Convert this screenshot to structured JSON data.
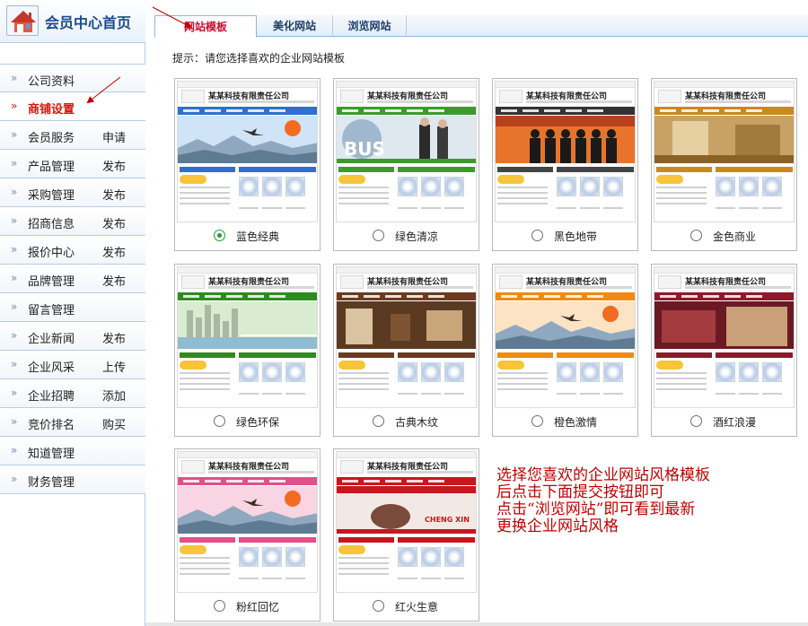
{
  "sidebar": {
    "title": "会员中心首页",
    "items": [
      {
        "label": "公司资料",
        "action": ""
      },
      {
        "label": "商铺设置",
        "action": "",
        "active": true
      },
      {
        "label": "会员服务",
        "action": "申请"
      },
      {
        "label": "产品管理",
        "action": "发布"
      },
      {
        "label": "采购管理",
        "action": "发布"
      },
      {
        "label": "招商信息",
        "action": "发布"
      },
      {
        "label": "报价中心",
        "action": "发布"
      },
      {
        "label": "品牌管理",
        "action": "发布"
      },
      {
        "label": "留言管理",
        "action": ""
      },
      {
        "label": "企业新闻",
        "action": "发布"
      },
      {
        "label": "企业风采",
        "action": "上传"
      },
      {
        "label": "企业招聘",
        "action": "添加"
      },
      {
        "label": "竞价排名",
        "action": "购买"
      },
      {
        "label": "知道管理",
        "action": ""
      },
      {
        "label": "财务管理",
        "action": ""
      }
    ]
  },
  "tabs": [
    {
      "label": "网站模板",
      "selected": true
    },
    {
      "label": "美化网站",
      "selected": false
    },
    {
      "label": "浏览网站",
      "selected": false
    }
  ],
  "hint": "提示：请您选择喜欢的企业网站模板",
  "thumb_company": "某某科技有限责任公司",
  "templates": [
    {
      "label": "蓝色经典",
      "selected": true,
      "nav": "#2f6fd1",
      "banner": "mountains-blue",
      "bar": "#2f6fd1"
    },
    {
      "label": "绿色清凉",
      "selected": false,
      "nav": "#3d9b2b",
      "banner": "business-handshake",
      "bar": "#3d9b2b"
    },
    {
      "label": "黑色地带",
      "selected": false,
      "nav": "#333333",
      "banner": "silhouettes-orange",
      "bar": "#444444"
    },
    {
      "label": "金色商业",
      "selected": false,
      "nav": "#c98a1c",
      "banner": "interior-gold",
      "bar": "#c98a1c"
    },
    {
      "label": "绿色环保",
      "selected": false,
      "nav": "#2e8b1f",
      "banner": "city-lake-green",
      "bar": "#2e8b1f"
    },
    {
      "label": "古典木纹",
      "selected": false,
      "nav": "#6b3a1f",
      "banner": "wood-interior",
      "bar": "#6b3a1f"
    },
    {
      "label": "橙色激情",
      "selected": false,
      "nav": "#f08a10",
      "banner": "mountains-orange",
      "bar": "#f08a10"
    },
    {
      "label": "酒红浪漫",
      "selected": false,
      "nav": "#8b1a2a",
      "banner": "wine-interior",
      "bar": "#8b1a2a"
    },
    {
      "label": "粉红回忆",
      "selected": false,
      "nav": "#e0508a",
      "banner": "mountains-pink",
      "bar": "#e0508a"
    },
    {
      "label": "红火生意",
      "selected": false,
      "nav": "#c8161e",
      "banner": "chengxin-red",
      "bar": "#c8161e"
    }
  ],
  "note": [
    "选择您喜欢的企业网站风格模板",
    "后点击下面提交按钮即可",
    "点击“浏览网站”即可看到最新",
    "更换企业网站风格"
  ],
  "colors": {
    "accent_red": "#c00000",
    "sidebar_border": "#b7cde3",
    "title_blue": "#1a4c8a"
  },
  "icons": {
    "logo": "house-icon",
    "menu_bullet": "double-chevron-icon"
  }
}
